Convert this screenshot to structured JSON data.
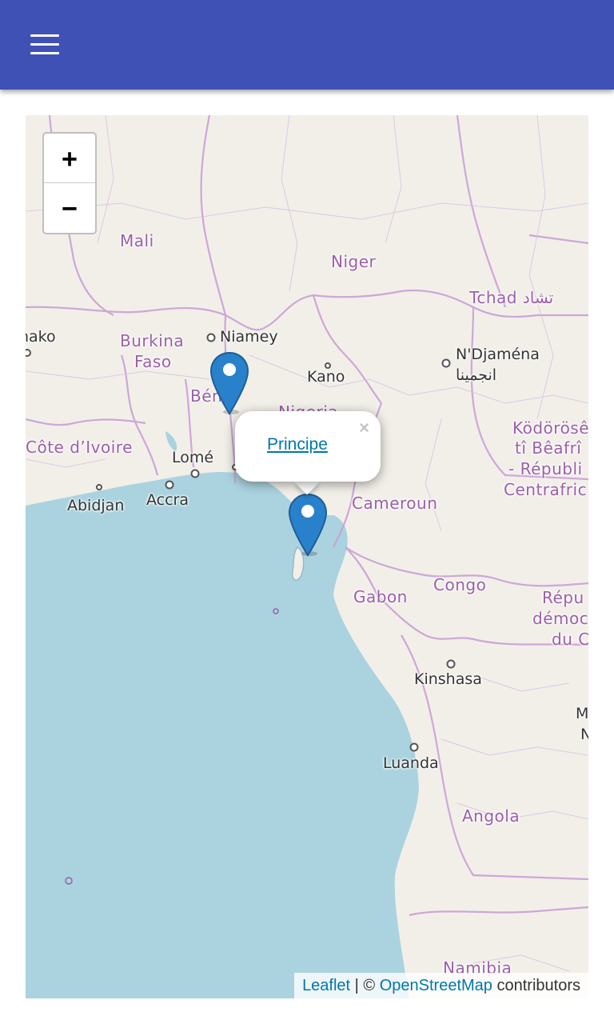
{
  "appbar": {
    "menu_icon": "hamburger-menu-icon",
    "color": "#3f51b5"
  },
  "map": {
    "zoom_in_label": "+",
    "zoom_out_label": "−",
    "ocean_color": "#aad3df",
    "land_color": "#f2efe9",
    "countries": [
      "Mali",
      "Niger",
      "Tchad تشاد",
      "Burkina",
      "Faso",
      "Bénin",
      "Nigeria",
      "Côte d’Ivoire",
      "Cameroun",
      "Gabon",
      "Congo",
      "Angola",
      "Namibia",
      "Ködörösê",
      "tî Bêafrî",
      "- Républi",
      "Centrafric",
      "Répu",
      "démoc",
      "du C"
    ],
    "cities": [
      "nako",
      "Niamey",
      "Kano",
      "N'Djaména",
      "انجمينا",
      "Lomé",
      "Accra",
      "Abidjan",
      "Kinshasa",
      "Luanda",
      "M",
      "N"
    ],
    "popup": {
      "link_text": "Principe",
      "close_symbol": "×"
    },
    "markers": [
      "map-marker-icon",
      "map-marker-icon"
    ],
    "attribution": {
      "leaflet": "Leaflet",
      "separator": " | © ",
      "osm": "OpenStreetMap",
      "suffix": " contributors"
    }
  }
}
